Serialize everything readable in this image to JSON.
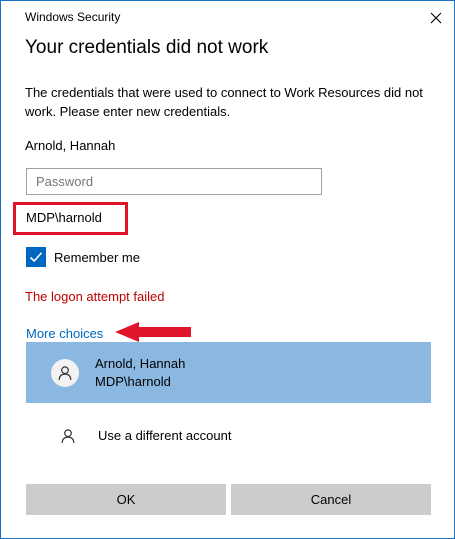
{
  "window": {
    "title": "Windows Security"
  },
  "dialog": {
    "heading": "Your credentials did not work",
    "message": "The credentials that were used to connect to Work Resources did not work. Please enter new credentials.",
    "user_name": "Arnold, Hannah",
    "password_placeholder": "Password",
    "password_value": "",
    "domain_user": "MDP\\harnold",
    "remember_label": "Remember me",
    "remember_checked": true,
    "error": "The logon attempt failed",
    "more_choices": "More choices"
  },
  "accounts": [
    {
      "name": "Arnold, Hannah",
      "domain_user": "MDP\\harnold",
      "selected": true
    },
    {
      "name": "Use a different account",
      "selected": false
    }
  ],
  "buttons": {
    "ok": "OK",
    "cancel": "Cancel"
  },
  "colors": {
    "accent": "#0067c0",
    "error": "#c00000",
    "selected_row": "#8ab8e0",
    "annotation_red": "#e0142a",
    "button_bg": "#cccccc"
  }
}
